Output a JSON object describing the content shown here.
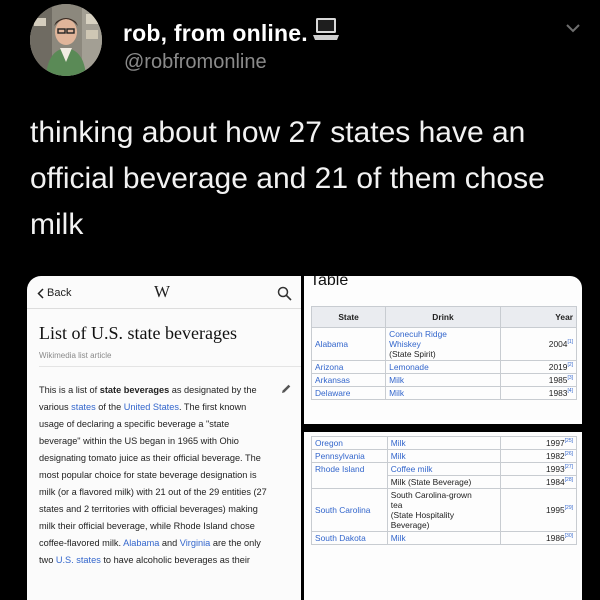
{
  "tweet": {
    "display_name": "rob, from online.",
    "handle": "@robfromonline",
    "text": "thinking about how 27 states have an official beverage and 21 of them chose milk"
  },
  "icons": {
    "avatar": "avatar-photo",
    "name_emoji": "laptop-icon",
    "menu": "chevron-down-icon",
    "back": "chevron-left-icon",
    "search": "search-icon",
    "edit": "pencil-icon"
  },
  "wiki": {
    "back_label": "Back",
    "logo": "W",
    "title": "List of U.S. state beverages",
    "subtitle": "Wikimedia list article",
    "body": {
      "t1": "This is a list of ",
      "t2": "state beverages",
      "t3": " as designated by the various ",
      "t4": "states",
      "t5": " of the ",
      "t6": "United States",
      "t7": ". The first known usage of declaring a specific beverage a \"state beverage\" within the US began in 1965 with Ohio designating tomato juice as their official beverage. The most popular choice for state beverage designation is milk (or a flavored milk) with 21 out of the 29 entities (27 states and 2 territories with official beverages) making milk their official beverage, while Rhode Island chose coffee-flavored milk. ",
      "t8": "Alabama",
      "t9": " and ",
      "t10": "Virginia",
      "t11": " are the only two ",
      "t12": "U.S. states",
      "t13": " to have alcoholic beverages as their"
    }
  },
  "table": {
    "heading": "Table",
    "headers": [
      "State",
      "Drink",
      "Year"
    ],
    "rows_top": [
      {
        "state": "Alabama",
        "drink": [
          "Conecuh Ridge",
          "Whiskey",
          "(State Spirit)"
        ],
        "year": "2004",
        "ref": "[1]"
      },
      {
        "state": "Arizona",
        "drink": [
          "Lemonade"
        ],
        "year": "2019",
        "ref": "[2]"
      },
      {
        "state": "Arkansas",
        "drink": [
          "Milk"
        ],
        "year": "1985",
        "ref": "[3]"
      },
      {
        "state": "Delaware",
        "drink": [
          "Milk"
        ],
        "year": "1983",
        "ref": "[4]"
      }
    ],
    "rows_bottom": [
      {
        "state": "Oregon",
        "drink": [
          "Milk"
        ],
        "year": "1997",
        "ref": "[25]"
      },
      {
        "state": "Pennsylvania",
        "drink": [
          "Milk"
        ],
        "year": "1982",
        "ref": "[26]"
      },
      {
        "state": "Rhode Island",
        "drink": [
          "Coffee milk"
        ],
        "year": "1993",
        "ref": "[27]"
      },
      {
        "state": "",
        "drink": [
          "Milk (State Beverage)"
        ],
        "year": "1984",
        "ref": "[28]"
      },
      {
        "state": "South Carolina",
        "drink": [
          "South Carolina-grown",
          "tea",
          "(State Hospitality",
          "Beverage)"
        ],
        "year": "1995",
        "ref": "[29]"
      },
      {
        "state": "South Dakota",
        "drink": [
          "Milk"
        ],
        "year": "1986",
        "ref": "[30]"
      }
    ]
  }
}
